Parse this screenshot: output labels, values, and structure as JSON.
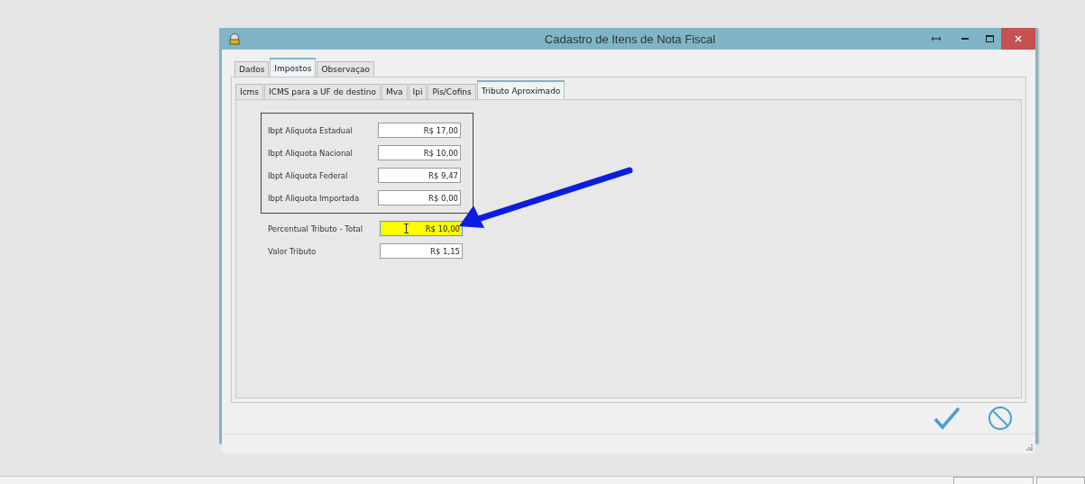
{
  "window": {
    "title": "Cadastro de Itens de Nota Fiscal"
  },
  "tabs": [
    {
      "label": "Dados",
      "selected": false
    },
    {
      "label": "Impostos",
      "selected": true
    },
    {
      "label": "Observaçao",
      "selected": false
    }
  ],
  "sub_tabs": [
    {
      "label": "Icms",
      "selected": false
    },
    {
      "label": "ICMS para a UF de destino",
      "selected": false
    },
    {
      "label": "Mva",
      "selected": false
    },
    {
      "label": "Ipi",
      "selected": false
    },
    {
      "label": "Pis/Cofins",
      "selected": false
    },
    {
      "label": "Tributo Aproximado",
      "selected": true
    }
  ],
  "group_fields": [
    {
      "label": "Ibpt Aliquota Estadual",
      "value": "R$ 17,00",
      "focused": false
    },
    {
      "label": "Ibpt Aliquota Nacional",
      "value": "R$ 10,00",
      "focused": false
    },
    {
      "label": "Ibpt Aliquota Federal",
      "value": "R$ 9,47",
      "focused": false
    },
    {
      "label": "Ibpt Aliquota Importada",
      "value": "R$ 0,00",
      "focused": false
    }
  ],
  "fields": [
    {
      "label": "Percentual Tributo - Total",
      "value": "R$ 10,00",
      "focused": true
    },
    {
      "label": "Valor Tributo",
      "value": "R$ 1,15",
      "focused": false
    }
  ]
}
